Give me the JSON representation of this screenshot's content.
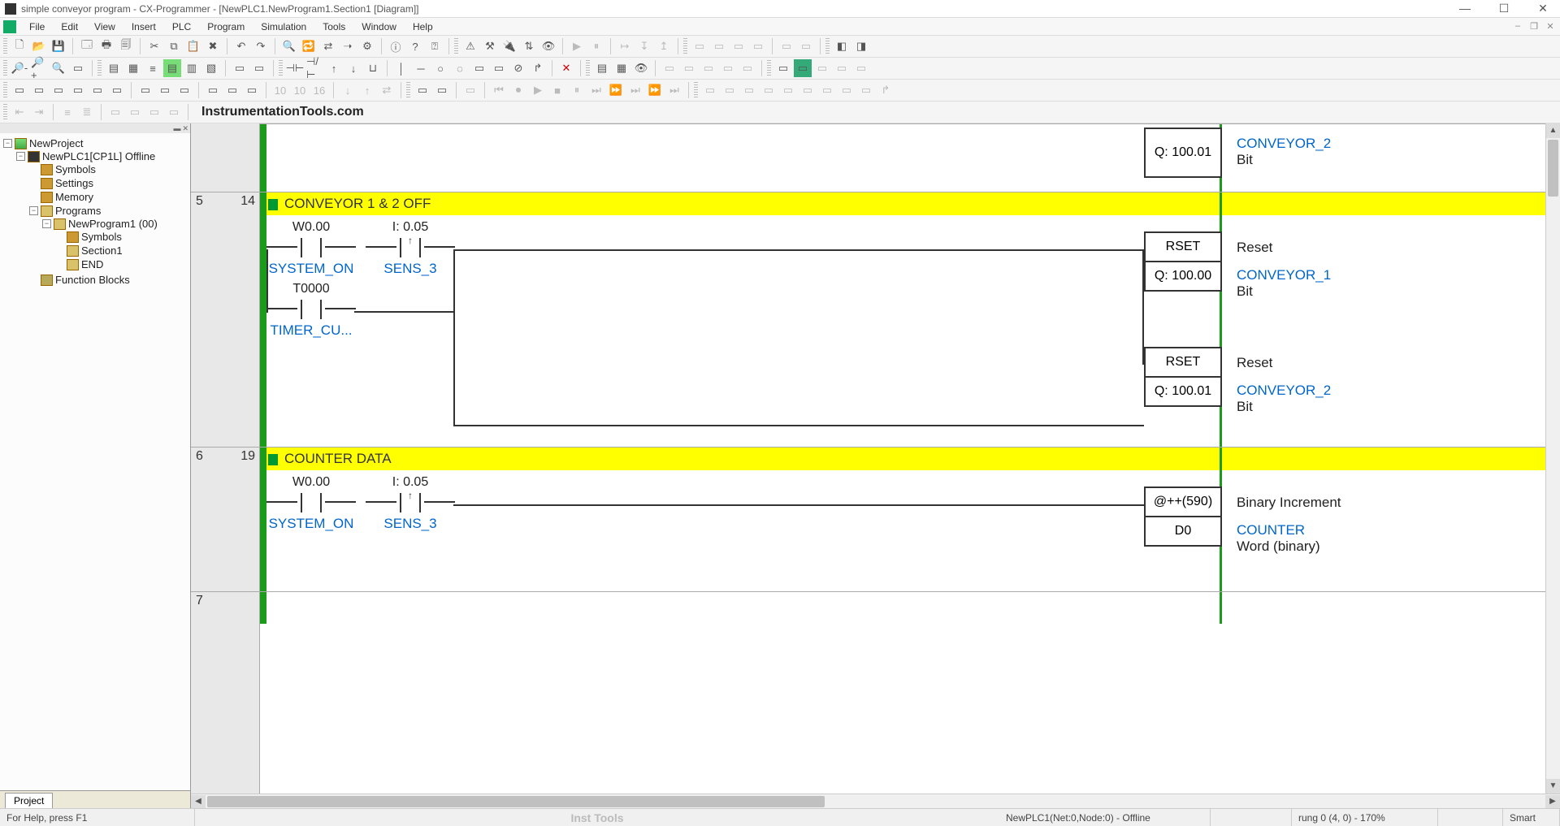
{
  "window": {
    "title": "simple conveyor program - CX-Programmer - [NewPLC1.NewProgram1.Section1 [Diagram]]"
  },
  "menu": {
    "items": [
      "File",
      "Edit",
      "View",
      "Insert",
      "PLC",
      "Program",
      "Simulation",
      "Tools",
      "Window",
      "Help"
    ]
  },
  "watermark": "InstrumentationTools.com",
  "footer_watermark": "Inst Tools",
  "tree": {
    "root": "NewProject",
    "plc": "NewPLC1[CP1L] Offline",
    "plc_children": [
      "Symbols",
      "Settings",
      "Memory"
    ],
    "programs": "Programs",
    "program": "NewProgram1 (00)",
    "program_children": [
      "Symbols",
      "Section1",
      "END"
    ],
    "fb": "Function Blocks"
  },
  "sidebar_tab": "Project",
  "diagram": {
    "rung_top": {
      "out_opd": "Q: 100.01",
      "desc_sym": "CONVEYOR_2",
      "desc_type": "Bit"
    },
    "rung5": {
      "num": "5",
      "step": "14",
      "title": "CONVEYOR 1 & 2 OFF",
      "c1_addr": "W0.00",
      "c1_sym": "SYSTEM_ON",
      "c2_addr": "I: 0.05",
      "c2_sym": "SENS_3",
      "c3_addr": "T0000",
      "c3_sym": "TIMER_CU...",
      "out1_op": "RSET",
      "out1_opd": "Q: 100.00",
      "out1_desc": "Reset",
      "out1_sym": "CONVEYOR_1",
      "out1_type": "Bit",
      "out2_op": "RSET",
      "out2_opd": "Q: 100.01",
      "out2_desc": "Reset",
      "out2_sym": "CONVEYOR_2",
      "out2_type": "Bit"
    },
    "rung6": {
      "num": "6",
      "step": "19",
      "title": "COUNTER DATA",
      "c1_addr": "W0.00",
      "c1_sym": "SYSTEM_ON",
      "c2_addr": "I: 0.05",
      "c2_sym": "SENS_3",
      "out_op": "@++(590)",
      "out_opd": "D0",
      "out_desc": "Binary Increment",
      "out_sym": "COUNTER",
      "out_type": "Word (binary)"
    },
    "rung7": {
      "num": "7"
    }
  },
  "status": {
    "help": "For Help, press F1",
    "conn": "NewPLC1(Net:0,Node:0) - Offline",
    "pos": "rung 0 (4, 0)  - 170%",
    "mode": "Smart"
  }
}
